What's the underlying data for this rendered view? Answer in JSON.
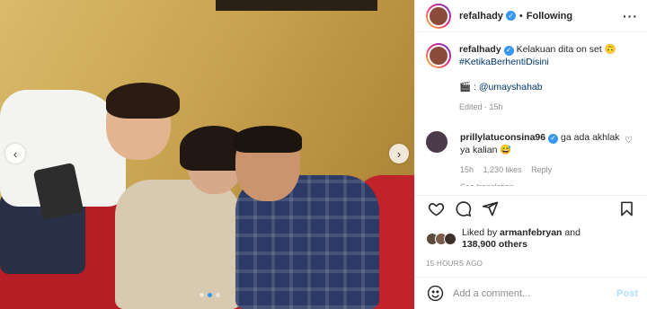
{
  "post": {
    "username": "refalhady",
    "follow_status": "Following",
    "more_icon": "more-horizontal-icon"
  },
  "caption": {
    "username": "refalhady",
    "text": "Kelakuan dita on set 🙃",
    "hashtag": "#KetikaBerhentiDisini",
    "credit_prefix": "🎬 : ",
    "credit_mention": "@umayshahab",
    "meta": "Edited · 15h"
  },
  "comment": {
    "username": "prillylatuconsina96",
    "text": "ga ada akhlak ya kalian 😅",
    "time": "15h",
    "likes": "1,230 likes",
    "reply": "Reply",
    "see_translation": "See translation"
  },
  "likes": {
    "prefix": "Liked by ",
    "user": "arman febryan",
    "user_display": "armanfebryan",
    "and": " and",
    "others": "138,900 others"
  },
  "timestamp": "15 HOURS AGO",
  "add_comment": {
    "placeholder": "Add a comment...",
    "post_label": "Post"
  },
  "carousel": {
    "prev": "‹",
    "next": "›",
    "total": 3,
    "active": 1
  },
  "colors": {
    "verified": "#3897f0",
    "link": "#00376b",
    "post_disabled": "#b2dffc",
    "sofa": "#b71d24"
  }
}
